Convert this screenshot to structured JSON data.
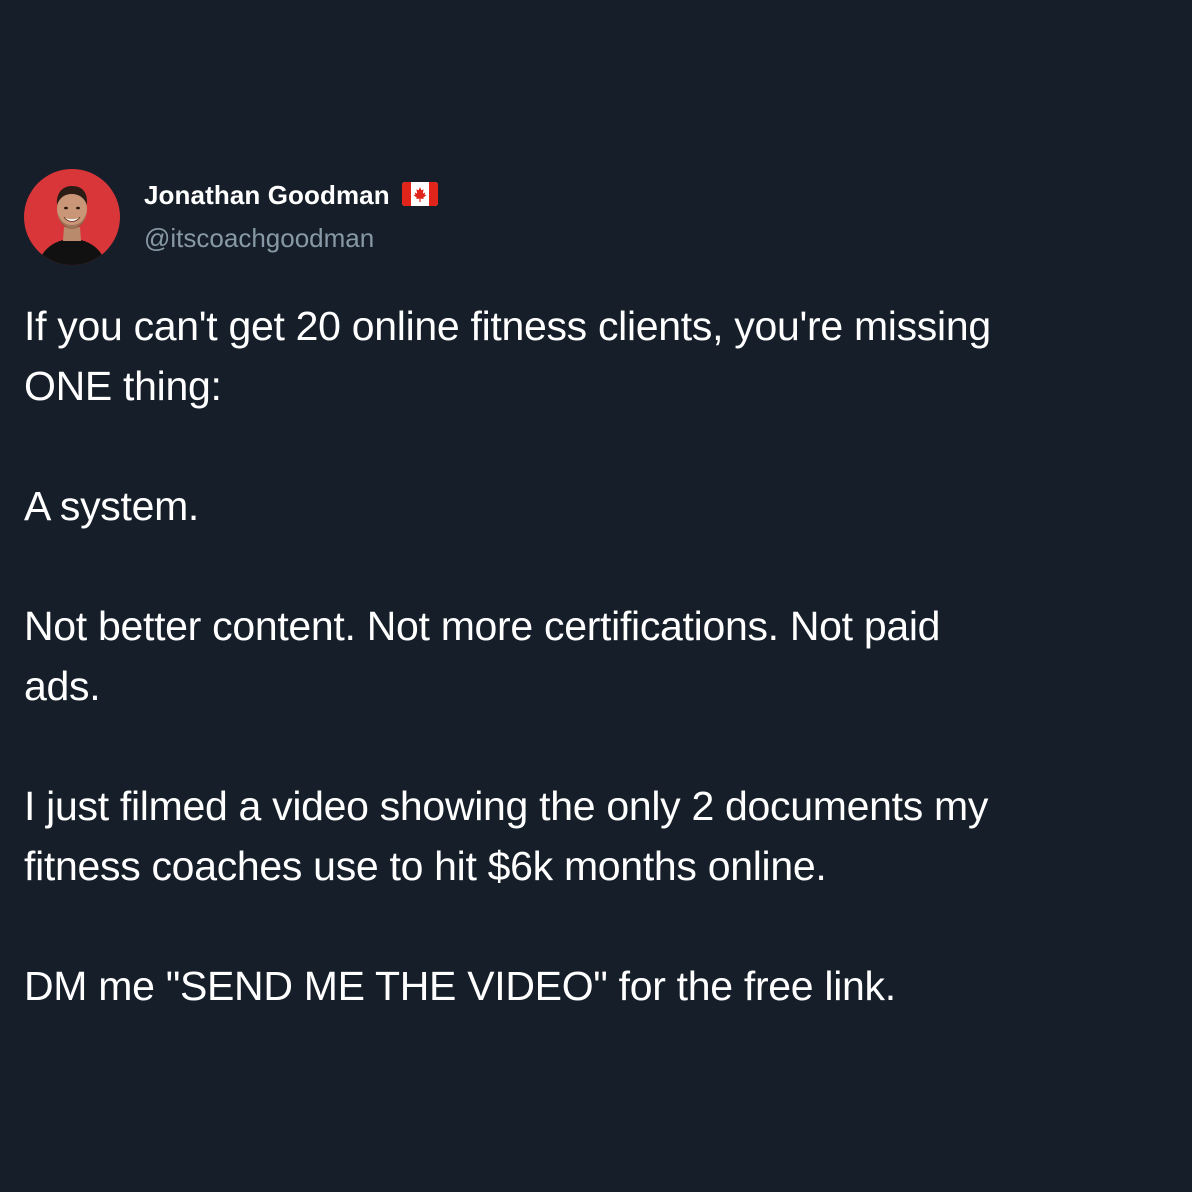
{
  "tweet": {
    "author": {
      "name": "Jonathan Goodman",
      "handle": "@itscoachgoodman",
      "flag_icon": "canada-flag-icon",
      "avatar_icon": "profile-photo"
    },
    "paragraphs": [
      "If you can't get 20 online fitness clients, you're missing\nONE thing:",
      "A system.",
      "Not better content. Not more certifications. Not paid\nads.",
      "I just filmed a video showing the only 2 documents my\nfitness coaches use to hit $6k months online.",
      "DM me \"SEND ME THE VIDEO\" for the free link."
    ]
  },
  "colors": {
    "background": "#161f29",
    "text_primary": "#ffffff",
    "text_secondary": "#8899a6",
    "avatar_background": "#d9363a",
    "flag_red": "#e1251b"
  }
}
